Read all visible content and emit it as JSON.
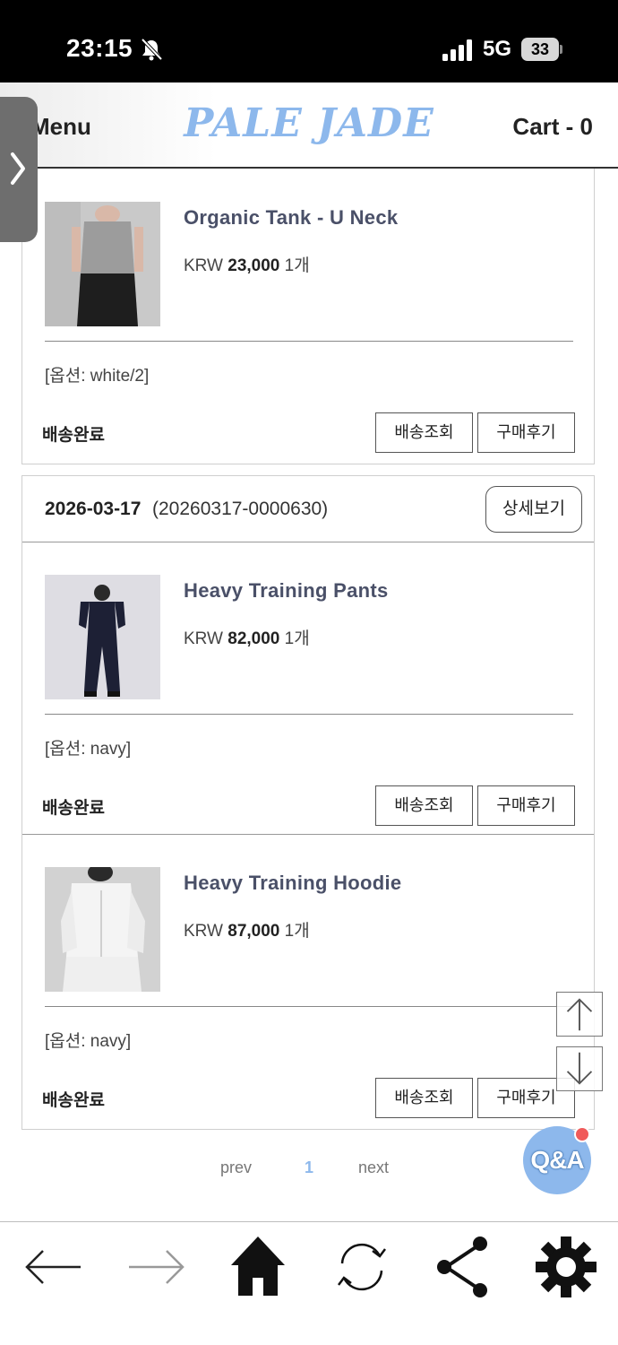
{
  "status_bar": {
    "time": "23:15",
    "network": "5G",
    "battery": "33"
  },
  "header": {
    "menu_label": "Menu",
    "logo": "PALE JADE",
    "cart_label": "Cart - 0"
  },
  "first_card": {
    "item": {
      "name": "Organic Tank - U Neck",
      "currency": "KRW",
      "price": "23,000",
      "quantity": "1개",
      "option": "[옵션: white/2]",
      "status": "배송완료",
      "track_button": "배송조회",
      "review_button": "구매후기"
    }
  },
  "second_order": {
    "date": "2026-03-17",
    "order_number": "(20260317-0000630)",
    "detail_button": "상세보기",
    "items": [
      {
        "name": "Heavy Training Pants",
        "currency": "KRW",
        "price": "82,000",
        "quantity": "1개",
        "option": "[옵션: navy]",
        "status": "배송완료",
        "track_button": "배송조회",
        "review_button": "구매후기"
      },
      {
        "name": "Heavy Training Hoodie",
        "currency": "KRW",
        "price": "87,000",
        "quantity": "1개",
        "option": "[옵션: navy]",
        "status": "배송완료",
        "track_button": "배송조회",
        "review_button": "구매후기"
      }
    ]
  },
  "pagination": {
    "prev": "prev",
    "current": "1",
    "next": "next"
  },
  "qa_button": "Q&A",
  "icons": {
    "side_tab": "chevron-right-icon",
    "scroll_up": "arrow-up-icon",
    "scroll_down": "arrow-down-icon",
    "toolbar": [
      "arrow-left-icon",
      "arrow-right-icon",
      "home-icon",
      "refresh-icon",
      "share-icon",
      "gear-icon"
    ]
  },
  "colors": {
    "brand": "#8db8ec",
    "product_name": "#4a5068",
    "notification": "#f05a5a"
  }
}
